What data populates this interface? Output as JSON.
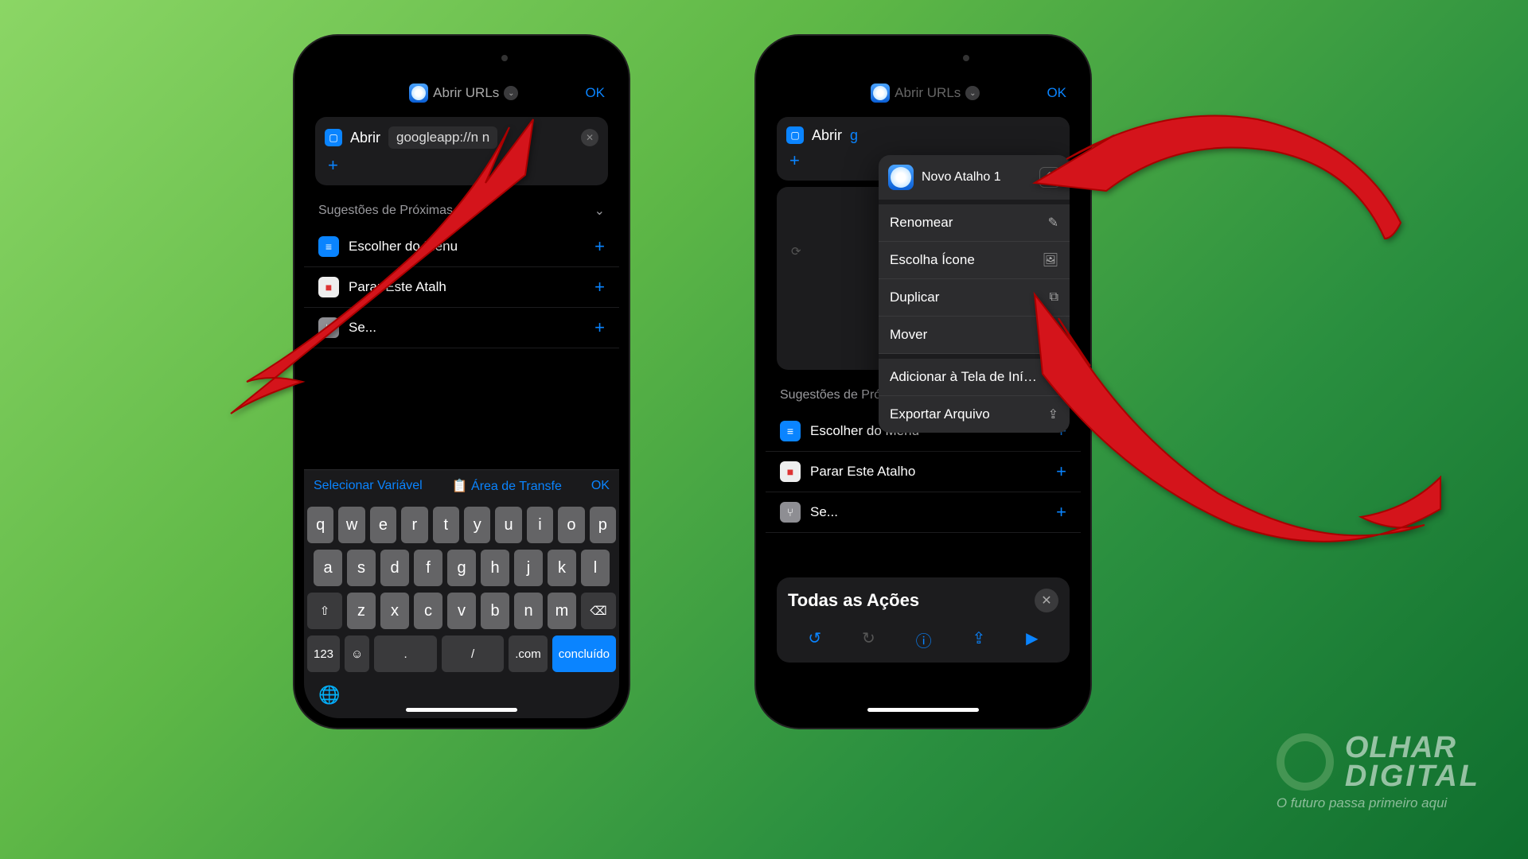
{
  "phone1": {
    "header": {
      "title": "Abrir URLs",
      "ok": "OK"
    },
    "action": {
      "verb": "Abrir",
      "url": "googleapp://n    n"
    },
    "suggestions_header": "Sugestões de Próximas A…",
    "suggestions": [
      {
        "label": "Escolher do Menu",
        "icon_bg": "#0a84ff"
      },
      {
        "label": "Parar Este Atalh",
        "icon_bg": "#eee"
      },
      {
        "label": "Se...",
        "icon_bg": "#8e8e93"
      }
    ],
    "kb_bar": {
      "sel": "Selecionar Variável",
      "clip": "Área de Transfe",
      "ok": "OK"
    },
    "keyboard": {
      "r1": [
        "q",
        "w",
        "e",
        "r",
        "t",
        "y",
        "u",
        "i",
        "o",
        "p"
      ],
      "r2": [
        "a",
        "s",
        "d",
        "f",
        "g",
        "h",
        "j",
        "k",
        "l"
      ],
      "r3": [
        "z",
        "x",
        "c",
        "v",
        "b",
        "n",
        "m"
      ],
      "num": "123",
      "dot": ".",
      "slash": "/",
      "com": ".com",
      "done": "concluído"
    }
  },
  "phone2": {
    "header": {
      "title": "Abrir URLs",
      "ok": "OK"
    },
    "action": {
      "verb": "Abrir",
      "url_prefix": "g"
    },
    "menu": {
      "title": "Novo Atalho 1",
      "items": [
        {
          "label": "Renomear",
          "icon": "✎"
        },
        {
          "label": "Escolha Ícone",
          "icon": "🖼"
        },
        {
          "label": "Duplicar",
          "icon": "⧉"
        },
        {
          "label": "Mover",
          "icon": ""
        }
      ],
      "items2": [
        {
          "label": "Adicionar à Tela de Iní…",
          "icon": "⊕"
        },
        {
          "label": "Exportar Arquivo",
          "icon": "⇪"
        }
      ]
    },
    "suggestions_header": "Sugestões de Próximas Ações",
    "suggestions": [
      {
        "label": "Escolher do Menu",
        "icon_bg": "#0a84ff"
      },
      {
        "label": "Parar Este Atalho",
        "icon_bg": "#eee"
      },
      {
        "label": "Se...",
        "icon_bg": "#8e8e93"
      }
    ],
    "actions_panel": {
      "title": "Todas as Ações"
    }
  },
  "watermark": {
    "line1": "OLHAR",
    "line2": "DIGITAL",
    "sub": "O futuro passa primeiro aqui"
  }
}
